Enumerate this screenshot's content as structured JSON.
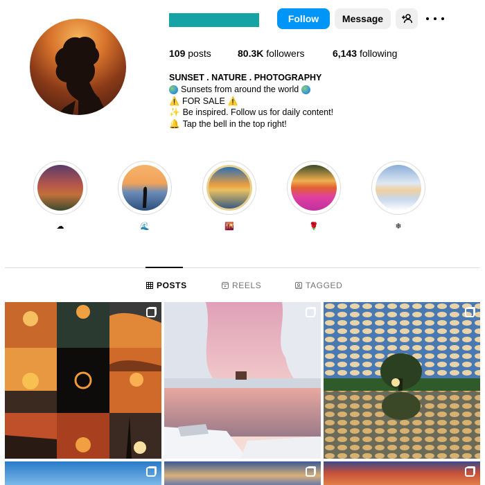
{
  "profile": {
    "follow_label": "Follow",
    "message_label": "Message",
    "add_user_icon": "add-user-icon",
    "more_icon": "more-options-icon",
    "accent_color": "#0095f6",
    "username_redaction_color": "#16a3a6"
  },
  "stats": {
    "posts_count": "109",
    "posts_label": "posts",
    "followers_count": "80.3K",
    "followers_label": "followers",
    "following_count": "6,143",
    "following_label": "following"
  },
  "bio": {
    "name": "SUNSET . NATURE . PHOTOGRAPHY",
    "line1": "Sunsets from around the world",
    "line2": "FOR SALE",
    "line3": "Be inspired. Follow us for daily content!",
    "line4": "Tap the bell in the top right!"
  },
  "highlights": [
    {
      "label": "☁",
      "theme": "red-rock-sunset"
    },
    {
      "label": "🌊",
      "theme": "silhouette-beach"
    },
    {
      "label": "🌇",
      "theme": "framed-sunset"
    },
    {
      "label": "🌹",
      "theme": "pink-flowers"
    },
    {
      "label": "❄",
      "theme": "snowy-trees"
    }
  ],
  "tabs": {
    "posts": "POSTS",
    "reels": "REELS",
    "tagged": "TAGGED"
  }
}
